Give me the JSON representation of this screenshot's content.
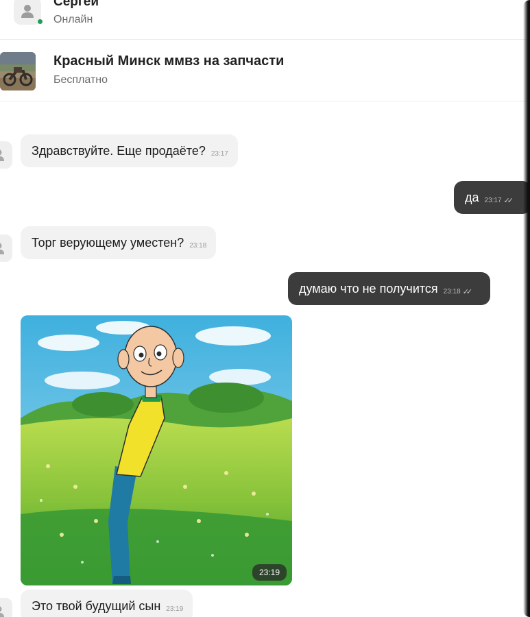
{
  "header": {
    "user_name": "Сергей",
    "status": "Онлайн",
    "status_color": "#1e9e5b",
    "avatar_icon": "user-icon"
  },
  "listing": {
    "title": "Красный Минск ммвз на запчасти",
    "price": "Бесплатно",
    "thumbnail": "motorcycle-photo"
  },
  "messages": [
    {
      "direction": "incoming",
      "text": "Здравствуйте. Еще продаёте?",
      "time": "23:17"
    },
    {
      "direction": "outgoing",
      "text": "да",
      "time": "23:17",
      "read_icon": "double-check-icon"
    },
    {
      "direction": "incoming",
      "text": "Торг верующему уместен?",
      "time": "23:18"
    },
    {
      "direction": "outgoing",
      "text": "думаю что не получится",
      "time": "23:18",
      "read_icon": "double-check-icon"
    },
    {
      "direction": "incoming",
      "type": "image",
      "image": "cartoon-boy-in-meadow",
      "time": "23:19"
    },
    {
      "direction": "incoming",
      "text": "Это твой будущий сын",
      "time": "23:19"
    }
  ],
  "colors": {
    "incoming_bubble": "#f2f2f2",
    "outgoing_bubble": "#3c3c3c"
  }
}
